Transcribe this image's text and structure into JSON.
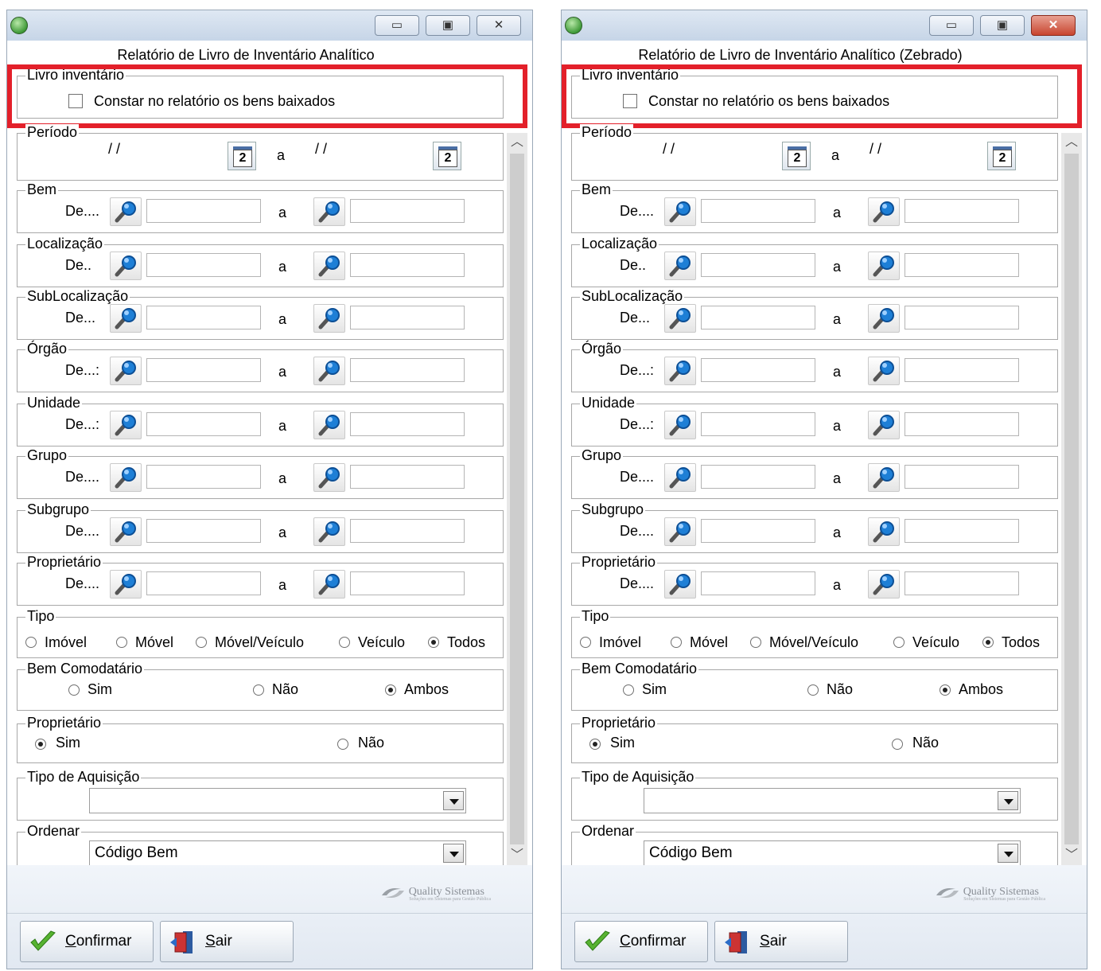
{
  "windows": [
    {
      "title": "Relatório de Livro de Inventário Analítico",
      "livro_inventario": {
        "legend": "Livro inventário",
        "checkbox_label": "Constar no relatório os bens baixados",
        "checked": false
      },
      "periodo": {
        "legend": "Período",
        "from_value": "/ /",
        "sep": "a",
        "to_value": "/ /"
      },
      "ranges": [
        {
          "legend": "Bem",
          "from_label": "De....",
          "sep": "a"
        },
        {
          "legend": "Localização",
          "from_label": "De..",
          "sep": "a"
        },
        {
          "legend": "SubLocalização",
          "from_label": "De...",
          "sep": "a"
        },
        {
          "legend": "Órgão",
          "from_label": "De...:",
          "sep": "a"
        },
        {
          "legend": "Unidade",
          "from_label": "De...:",
          "sep": "a"
        },
        {
          "legend": "Grupo",
          "from_label": "De....",
          "sep": "a"
        },
        {
          "legend": "Subgrupo",
          "from_label": "De....",
          "sep": "a"
        },
        {
          "legend": "Proprietário",
          "from_label": "De....",
          "sep": "a"
        }
      ],
      "tipo": {
        "legend": "Tipo",
        "options": [
          "Imóvel",
          "Móvel",
          "Móvel/Veículo",
          "Veículo",
          "Todos"
        ],
        "selected": 4
      },
      "bem_comodatario": {
        "legend": "Bem Comodatário",
        "options": [
          "Sim",
          "Não",
          "Ambos"
        ],
        "selected": 2
      },
      "proprietario": {
        "legend": "Proprietário",
        "options": [
          "Sim",
          "Não"
        ],
        "selected": 0
      },
      "tipo_aquisicao": {
        "legend": "Tipo de Aquisição",
        "value": ""
      },
      "ordenar": {
        "legend": "Ordenar",
        "value": "Código Bem"
      },
      "brand": {
        "name": "Quality Sistemas",
        "tagline": "Soluções em Sistemas para Gestão Pública"
      },
      "buttons": {
        "confirm": "Confirmar",
        "exit": "Sair"
      }
    },
    {
      "title": "Relatório de Livro de Inventário Analítico (Zebrado)",
      "livro_inventario": {
        "legend": "Livro inventário",
        "checkbox_label": "Constar no relatório os bens baixados",
        "checked": false
      },
      "periodo": {
        "legend": "Período",
        "from_value": "/ /",
        "sep": "a",
        "to_value": "/ /"
      },
      "ranges": [
        {
          "legend": "Bem",
          "from_label": "De....",
          "sep": "a"
        },
        {
          "legend": "Localização",
          "from_label": "De..",
          "sep": "a"
        },
        {
          "legend": "SubLocalização",
          "from_label": "De...",
          "sep": "a"
        },
        {
          "legend": "Órgão",
          "from_label": "De...:",
          "sep": "a"
        },
        {
          "legend": "Unidade",
          "from_label": "De...:",
          "sep": "a"
        },
        {
          "legend": "Grupo",
          "from_label": "De....",
          "sep": "a"
        },
        {
          "legend": "Subgrupo",
          "from_label": "De....",
          "sep": "a"
        },
        {
          "legend": "Proprietário",
          "from_label": "De....",
          "sep": "a"
        }
      ],
      "tipo": {
        "legend": "Tipo",
        "options": [
          "Imóvel",
          "Móvel",
          "Móvel/Veículo",
          "Veículo",
          "Todos"
        ],
        "selected": 4
      },
      "bem_comodatario": {
        "legend": "Bem Comodatário",
        "options": [
          "Sim",
          "Não",
          "Ambos"
        ],
        "selected": 2
      },
      "proprietario": {
        "legend": "Proprietário",
        "options": [
          "Sim",
          "Não"
        ],
        "selected": 0
      },
      "tipo_aquisicao": {
        "legend": "Tipo de Aquisição",
        "value": ""
      },
      "ordenar": {
        "legend": "Ordenar",
        "value": "Código Bem"
      },
      "brand": {
        "name": "Quality Sistemas",
        "tagline": "Soluções em Sistemas para Gestão Pública"
      },
      "buttons": {
        "confirm": "Confirmar",
        "exit": "Sair"
      }
    }
  ],
  "colors": {
    "highlight": "#e3202a",
    "close_button_active": "#c8452f"
  },
  "icons": [
    "app-icon",
    "minimize-icon",
    "maximize-icon",
    "close-icon",
    "calendar-icon",
    "magnifier-icon",
    "checkmark-icon",
    "exit-door-icon",
    "quality-swoosh-logo"
  ]
}
